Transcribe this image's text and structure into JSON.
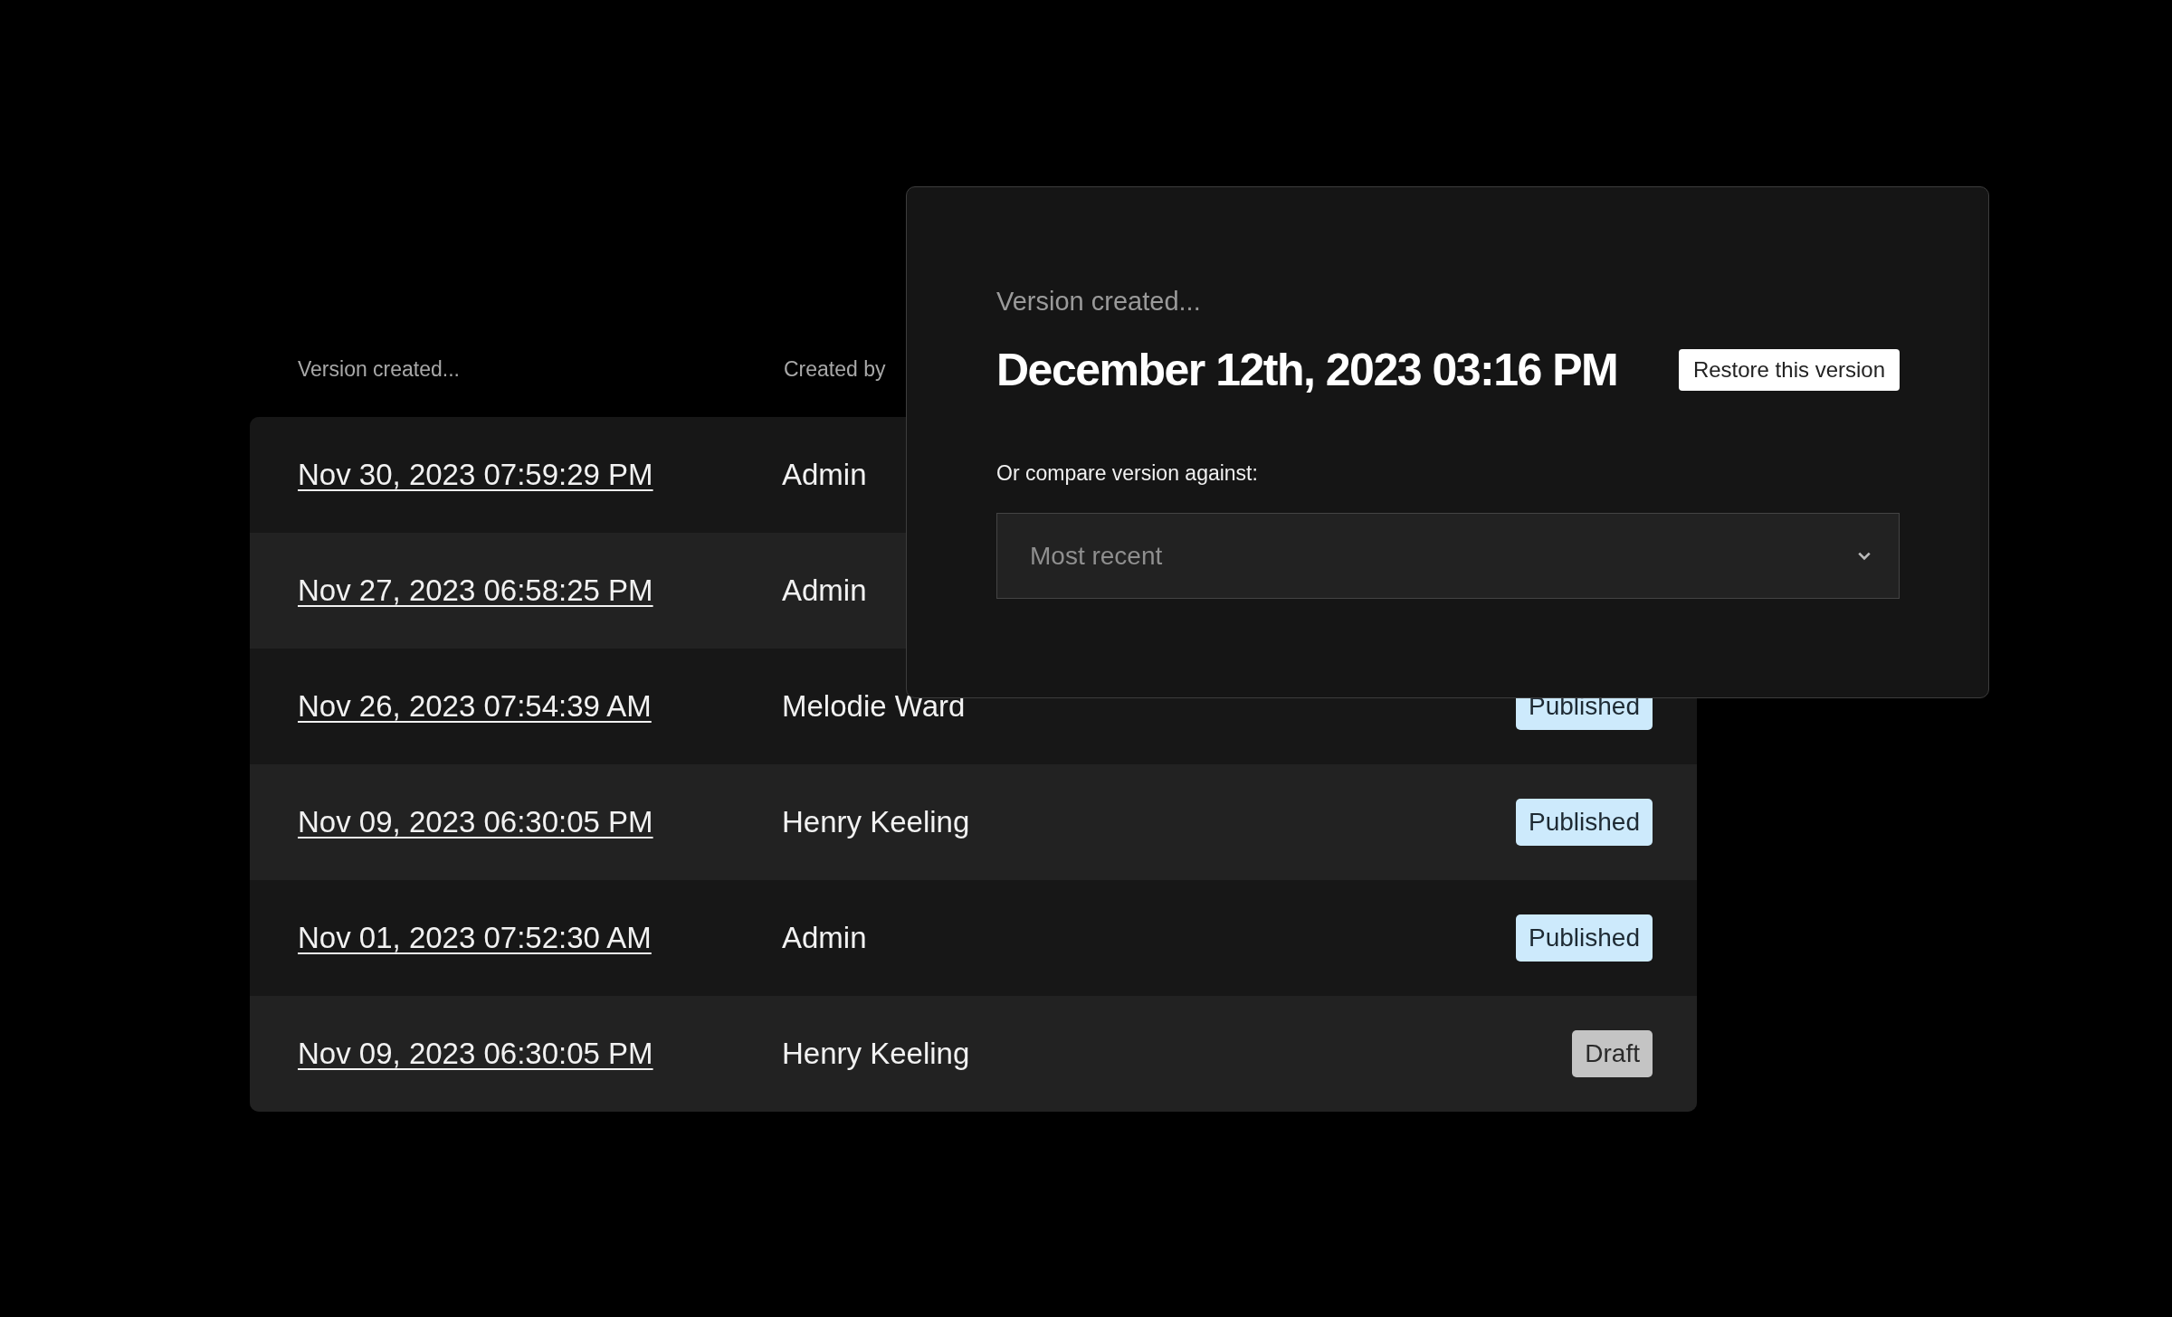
{
  "table": {
    "columns": [
      "Version created...",
      "Created by"
    ],
    "rows": [
      {
        "date": "Nov 30, 2023 07:59:29 PM",
        "created_by": "Admin"
      },
      {
        "date": "Nov 27, 2023 06:58:25 PM",
        "created_by": "Admin"
      },
      {
        "date": "Nov 26, 2023 07:54:39 AM",
        "created_by": "Melodie Ward",
        "status": {
          "kind": "published",
          "label": "Published"
        }
      },
      {
        "date": "Nov 09, 2023 06:30:05 PM",
        "created_by": "Henry Keeling",
        "status": {
          "kind": "published",
          "label": "Published"
        }
      },
      {
        "date": "Nov 01, 2023 07:52:30 AM",
        "created_by": "Admin",
        "status": {
          "kind": "published",
          "label": "Published"
        }
      },
      {
        "date": "Nov 09, 2023 06:30:05 PM",
        "created_by": "Henry Keeling",
        "status": {
          "kind": "draft",
          "label": "Draft"
        }
      }
    ]
  },
  "dialog": {
    "eyebrow": "Version created...",
    "title": "December 12th, 2023 03:16 PM",
    "restore_button": "Restore this version",
    "compare_label": "Or compare version against:",
    "compare_select": {
      "value": "Most recent"
    }
  }
}
